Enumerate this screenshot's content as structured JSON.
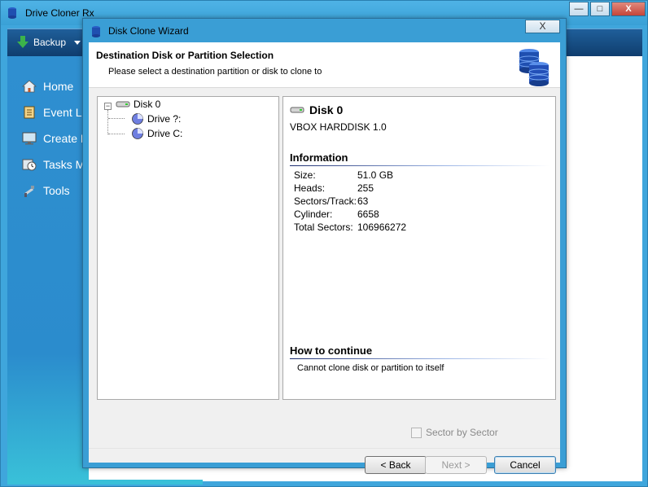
{
  "main_window": {
    "title": "Drive Cloner Rx",
    "controls": {
      "minimize": "—",
      "maximize": "□",
      "close": "X"
    },
    "toolbar": {
      "backup_label": "Backup"
    },
    "nav": [
      {
        "label": "Home",
        "icon": "home-icon"
      },
      {
        "label": "Event Lo",
        "icon": "event-log-icon"
      },
      {
        "label": "Create R",
        "icon": "monitor-icon"
      },
      {
        "label": "Tasks M",
        "icon": "clock-icon"
      },
      {
        "label": "Tools",
        "icon": "tools-icon"
      }
    ]
  },
  "dialog": {
    "title": "Disk Clone Wizard",
    "close_label": "X",
    "header": {
      "title": "Destination Disk or Partition Selection",
      "subtitle": "Please select a destination partition or disk to clone to"
    },
    "tree": {
      "disk": "Disk 0",
      "partitions": [
        "Drive ?:",
        "Drive C:"
      ]
    },
    "details": {
      "disk_name": "Disk 0",
      "model": "VBOX HARDDISK 1.0",
      "information_title": "Information",
      "info": [
        {
          "key": "Size:",
          "value": "51.0 GB"
        },
        {
          "key": "Heads:",
          "value": "255"
        },
        {
          "key": "Sectors/Track:",
          "value": "63"
        },
        {
          "key": "Cylinder:",
          "value": "6658"
        },
        {
          "key": "Total Sectors:",
          "value": "106966272"
        }
      ],
      "continue_title": "How to continue",
      "continue_text": "Cannot clone disk or partition to itself"
    },
    "sector_by_sector_label": "Sector by Sector",
    "buttons": {
      "back": "< Back",
      "next": "Next >",
      "cancel": "Cancel"
    }
  },
  "colors": {
    "window_blue": "#3fa6dc",
    "toolbar_navy": "#0f3d6e",
    "nav_cyan": "#39c0d8"
  }
}
